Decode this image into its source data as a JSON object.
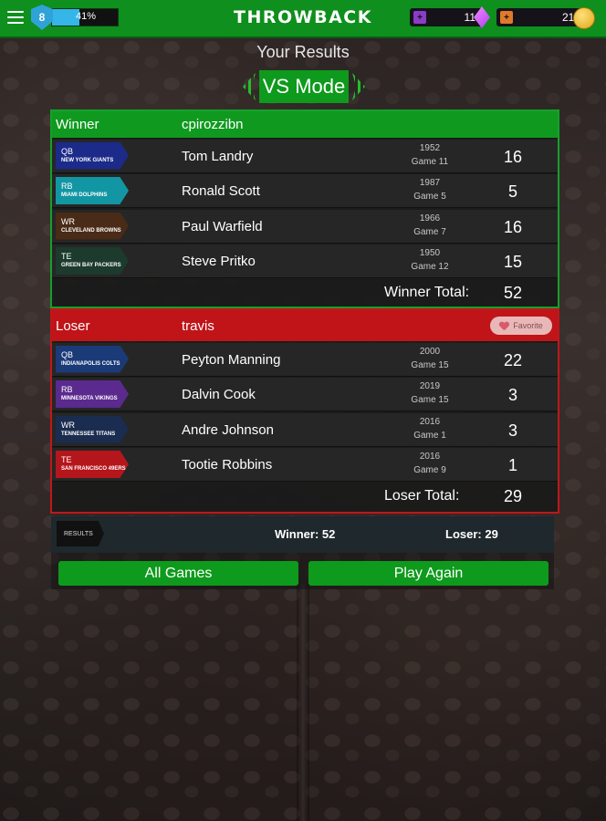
{
  "topbar": {
    "title": "THROWBACK",
    "level": "8",
    "xp_percent_label": "41%",
    "xp_fraction": 0.41,
    "gems": "11",
    "coins": "216",
    "colors": {
      "bar": "#0f8f1d",
      "xp": "#35b5e8",
      "gem": "#b13cf0",
      "coin": "#e2a617"
    }
  },
  "subtitle": "Your Results",
  "mode_title": "VS Mode",
  "winner_panel": {
    "label": "Winner",
    "user": "cpirozzibn",
    "players": [
      {
        "pos": "QB",
        "team": "NEW YORK GIANTS",
        "color": "#1c2b8a",
        "name": "Tom Landry",
        "year": "1952",
        "game": "Game 11",
        "score": "16"
      },
      {
        "pos": "RB",
        "team": "MIAMI DOLPHINS",
        "color": "#1396a3",
        "name": "Ronald Scott",
        "year": "1987",
        "game": "Game 5",
        "score": "5"
      },
      {
        "pos": "WR",
        "team": "CLEVELAND BROWNS",
        "color": "#4a2b17",
        "name": "Paul Warfield",
        "year": "1966",
        "game": "Game 7",
        "score": "16"
      },
      {
        "pos": "TE",
        "team": "GREEN BAY PACKERS",
        "color": "#1c3b2d",
        "name": "Steve Pritko",
        "year": "1950",
        "game": "Game 12",
        "score": "15"
      }
    ],
    "total_label": "Winner Total:",
    "total": "52"
  },
  "loser_panel": {
    "label": "Loser",
    "user": "travis",
    "favorite_label": "Favorite",
    "players": [
      {
        "pos": "QB",
        "team": "INDIANAPOLIS COLTS",
        "color": "#1b3a78",
        "name": "Peyton Manning",
        "year": "2000",
        "game": "Game 15",
        "score": "22"
      },
      {
        "pos": "RB",
        "team": "MINNESOTA VIKINGS",
        "color": "#5a2a8e",
        "name": "Dalvin Cook",
        "year": "2019",
        "game": "Game 15",
        "score": "3"
      },
      {
        "pos": "WR",
        "team": "TENNESSEE TITANS",
        "color": "#1a2c4f",
        "name": "Andre Johnson",
        "year": "2016",
        "game": "Game 1",
        "score": "3"
      },
      {
        "pos": "TE",
        "team": "SAN FRANCISCO 49ERS",
        "color": "#b5161c",
        "name": "Tootie Robbins",
        "year": "2016",
        "game": "Game 9",
        "score": "1"
      }
    ],
    "total_label": "Loser Total:",
    "total": "29"
  },
  "summary": {
    "tag": "RESULTS",
    "winner": "Winner: 52",
    "loser": "Loser: 29"
  },
  "buttons": {
    "all_games": "All Games",
    "play_again": "Play Again"
  }
}
